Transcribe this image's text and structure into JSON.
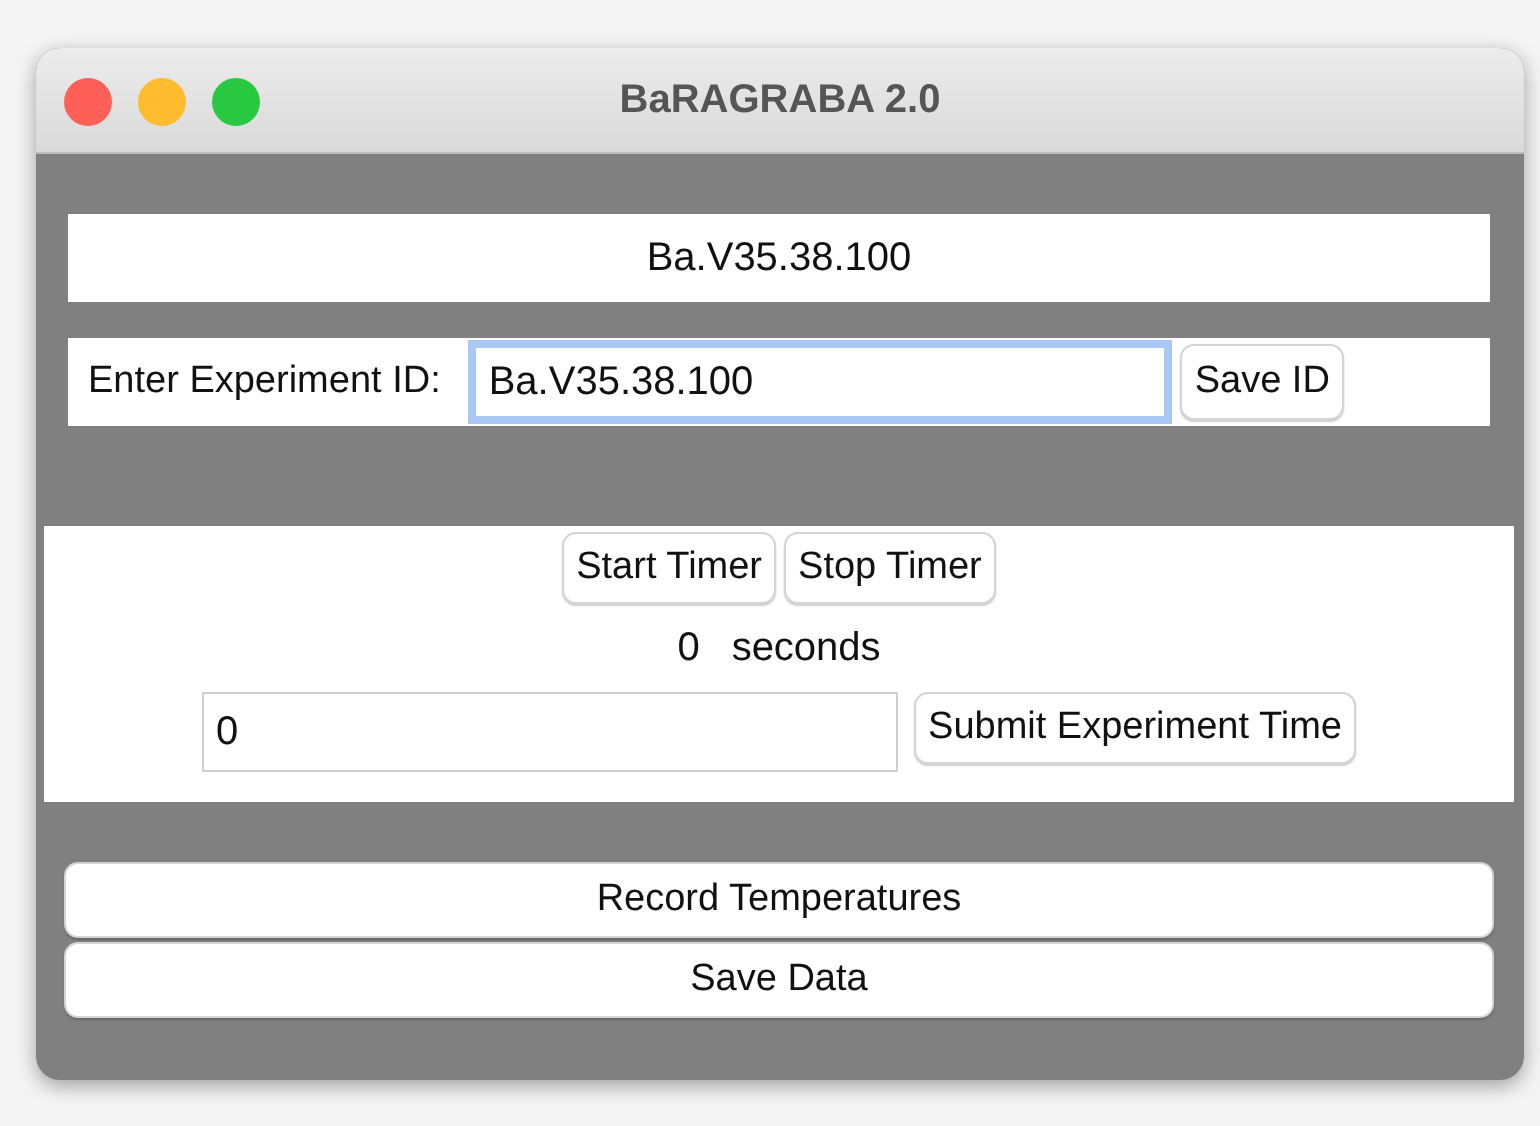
{
  "window": {
    "title": "BaRAGRABA 2.0"
  },
  "id_display": "Ba.V35.38.100",
  "id_row": {
    "label": "Enter Experiment ID:",
    "field": {
      "value": "Ba.V35.38.100",
      "focused": true
    },
    "button": "Save ID"
  },
  "timer_buttons": [
    "Start Timer",
    "Stop Timer"
  ],
  "timer_reading": {
    "value": "0",
    "unit": "seconds"
  },
  "time_row": {
    "field": {
      "value": "0",
      "focused": false
    },
    "button": "Submit Experiment Time"
  },
  "action_buttons": [
    "Record Temperatures",
    "Save Data"
  ]
}
